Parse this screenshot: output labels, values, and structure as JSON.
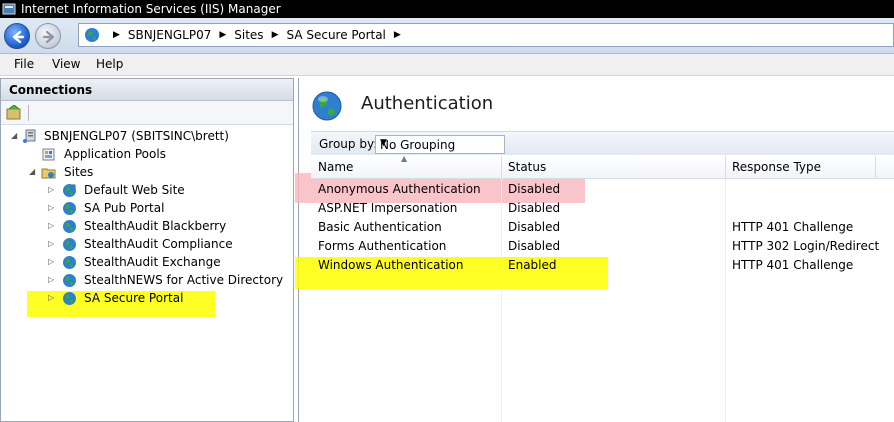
{
  "window": {
    "title": "Internet Information Services (IIS) Manager"
  },
  "address": {
    "crumbs": [
      "SBNJENGLP07",
      "Sites",
      "SA Secure Portal"
    ]
  },
  "menu": {
    "file": "File",
    "view": "View",
    "help": "Help"
  },
  "connections": {
    "header": "Connections",
    "tree": {
      "server": "SBNJENGLP07 (SBITSINC\\brett)",
      "app_pools": "Application Pools",
      "sites": "Sites",
      "site_items": [
        "Default Web Site",
        "SA Pub Portal",
        "StealthAudit Blackberry",
        "StealthAudit Compliance",
        "StealthAudit Exchange",
        "StealthNEWS for Active Directory",
        "SA Secure Portal"
      ],
      "selected": "SA Secure Portal"
    }
  },
  "feature": {
    "title": "Authentication",
    "group_by_label": "Group by:",
    "group_by_value": "No Grouping",
    "columns": [
      "Name",
      "Status",
      "Response Type"
    ],
    "rows": [
      {
        "name": "Anonymous Authentication",
        "status": "Disabled",
        "response": ""
      },
      {
        "name": "ASP.NET Impersonation",
        "status": "Disabled",
        "response": ""
      },
      {
        "name": "Basic Authentication",
        "status": "Disabled",
        "response": "HTTP 401 Challenge"
      },
      {
        "name": "Forms Authentication",
        "status": "Disabled",
        "response": "HTTP 302 Login/Redirect"
      },
      {
        "name": "Windows Authentication",
        "status": "Enabled",
        "response": "HTTP 401 Challenge"
      }
    ]
  },
  "colors": {
    "highlight_yellow": "#ffff00",
    "highlight_pink": "#f7b7bd",
    "address_bar": "#dfe9f5"
  }
}
